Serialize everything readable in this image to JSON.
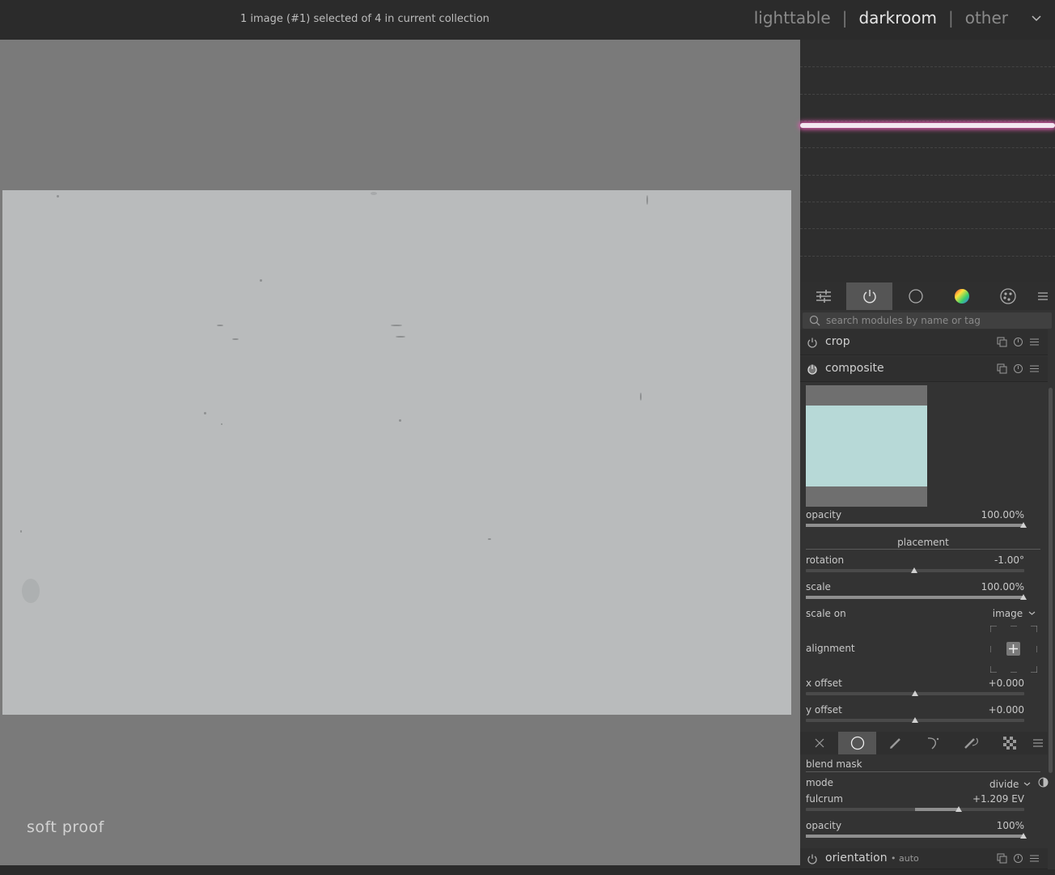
{
  "topbar": {
    "selection_info": "1 image (#1) selected of 4 in current collection",
    "views": [
      "lighttable",
      "darkroom",
      "other"
    ],
    "active_view": "darkroom",
    "separator": "|",
    "expand_icon": "chevron-down-icon"
  },
  "center": {
    "soft_proof_label": "soft proof"
  },
  "module_tabs": {
    "icons": [
      "sliders-icon",
      "power-icon",
      "circle-icon",
      "color-wheel-icon",
      "palette-icon",
      "menu-icon"
    ],
    "active": "power-icon"
  },
  "search": {
    "placeholder": "search modules by name or tag"
  },
  "modules": {
    "crop": {
      "name": "crop"
    },
    "composite": {
      "name": "composite"
    },
    "orientation": {
      "name": "orientation",
      "sub": "• auto"
    }
  },
  "composite": {
    "opacity_label": "opacity",
    "opacity_value": "100.00%",
    "placement_label": "placement",
    "rotation_label": "rotation",
    "rotation_value": "-1.00°",
    "scale_label": "scale",
    "scale_value": "100.00%",
    "scale_on_label": "scale on",
    "scale_on_value": "image",
    "alignment_label": "alignment",
    "x_offset_label": "x offset",
    "x_offset_value": "+0.000",
    "y_offset_label": "y offset",
    "y_offset_value": "+0.000"
  },
  "blend": {
    "tab_icons": [
      "close-icon",
      "uniform-icon",
      "pencil-icon",
      "parametric-icon",
      "drawn-parametric-icon",
      "raster-icon",
      "menu-icon"
    ],
    "active": "uniform-icon",
    "section_label": "blend mask",
    "mode_label": "mode",
    "mode_value": "divide",
    "fulcrum_label": "fulcrum",
    "fulcrum_value": "+1.209 EV",
    "opacity_label": "opacity",
    "opacity_value": "100%"
  },
  "colors": {
    "accent_histogram": "#d85aa8",
    "composite_preview": "#b7d9d7"
  }
}
